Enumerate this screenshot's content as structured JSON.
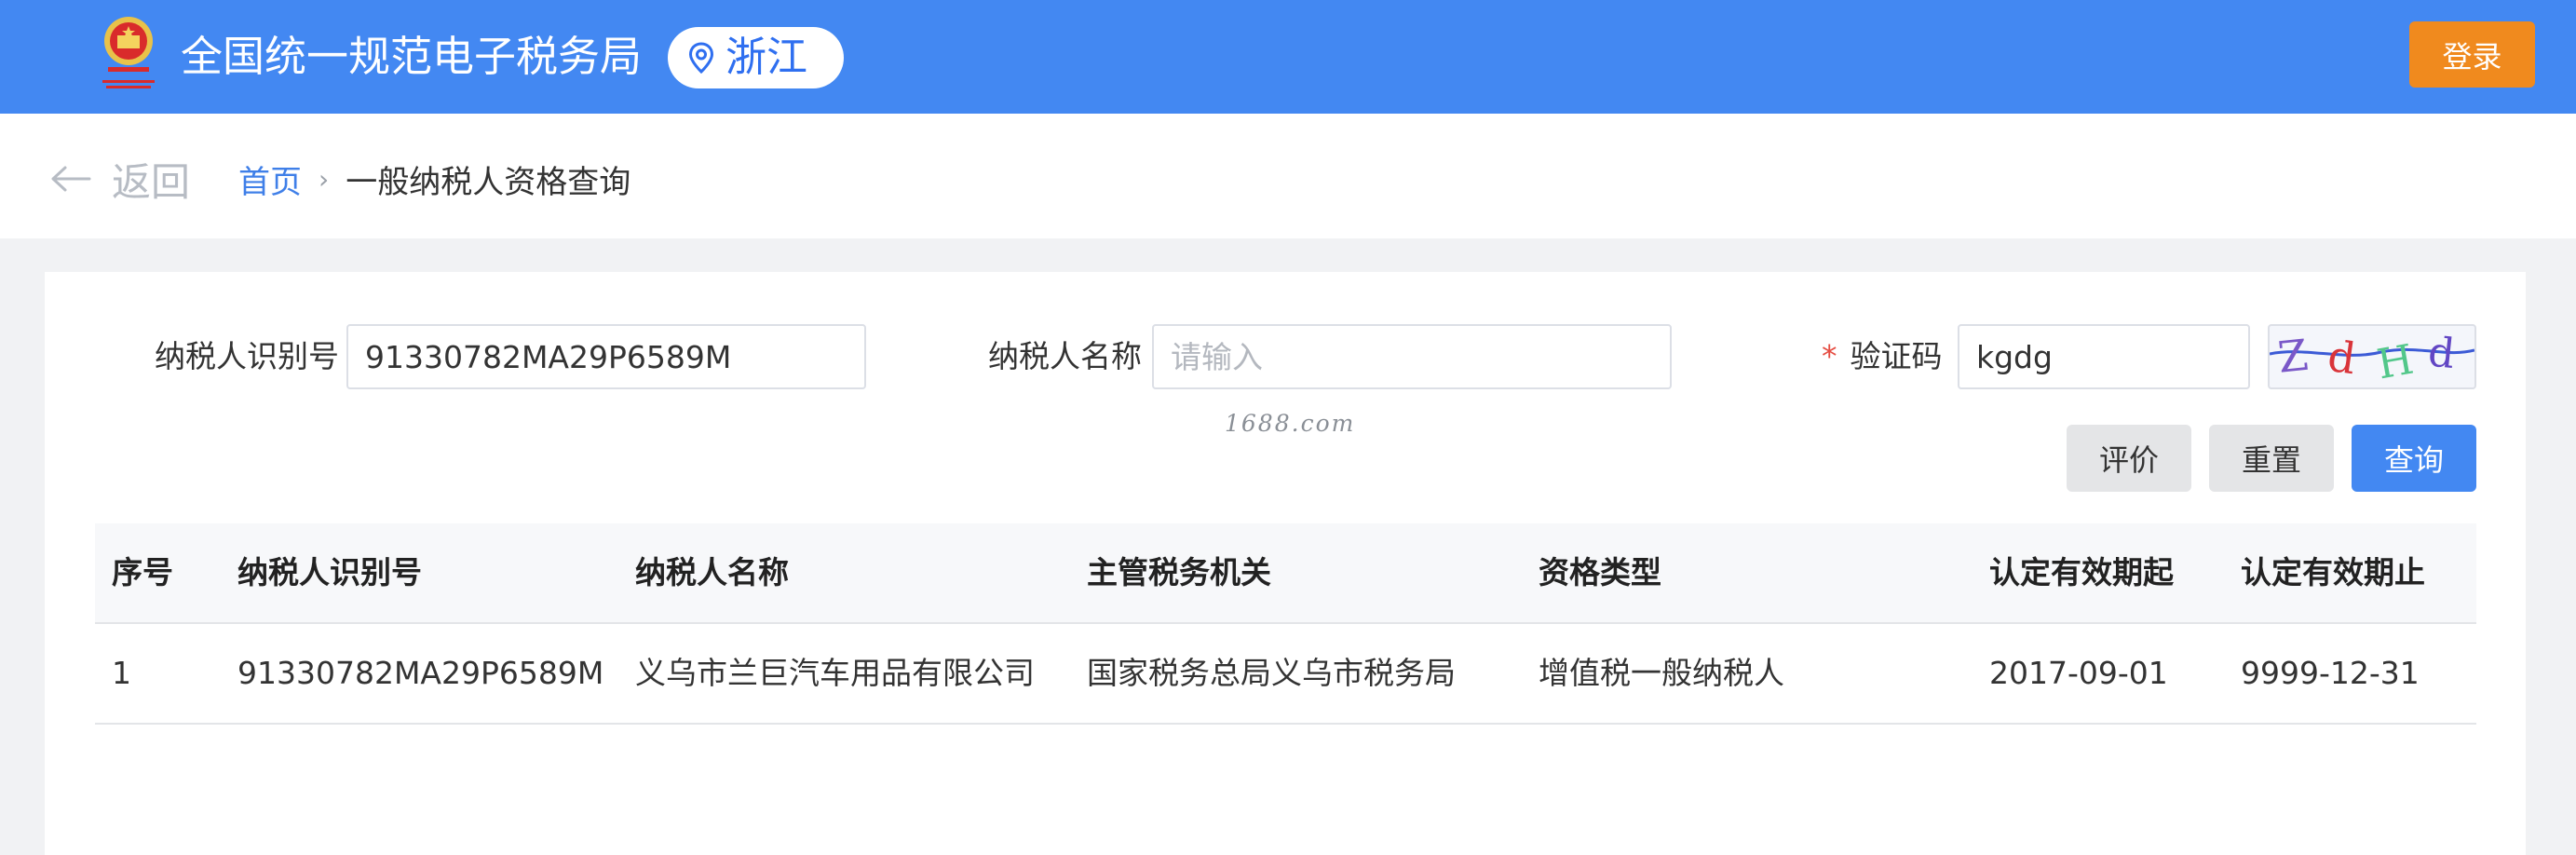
{
  "header": {
    "site_title": "全国统一规范电子税务局",
    "region": "浙江",
    "login_label": "登录",
    "emblem_icon": "national-emblem-icon",
    "pin_icon": "location-pin-icon"
  },
  "breadcrumb": {
    "back_label": "返回",
    "home_label": "首页",
    "separator": "›",
    "current_label": "一般纳税人资格查询"
  },
  "form": {
    "taxpayer_id_label": "纳税人识别号",
    "taxpayer_id_value": "91330782MA29P6589M",
    "taxpayer_name_label": "纳税人名称",
    "taxpayer_name_placeholder": "请输入",
    "taxpayer_name_value": "",
    "required_mark": "*",
    "captcha_label": "验证码",
    "captcha_value": "kgdg",
    "captcha_image_text": "ZdHd"
  },
  "watermark": "1688.com",
  "buttons": {
    "rate_label": "评价",
    "reset_label": "重置",
    "query_label": "查询"
  },
  "table": {
    "columns": [
      "序号",
      "纳税人识别号",
      "纳税人名称",
      "主管税务机关",
      "资格类型",
      "认定有效期起",
      "认定有效期止"
    ],
    "rows": [
      [
        "1",
        "91330782MA29P6589M",
        "义乌市兰巨汽车用品有限公司",
        "国家税务总局义乌市税务局",
        "增值税一般纳税人",
        "2017-09-01",
        "9999-12-31"
      ]
    ]
  },
  "colors": {
    "header_blue": "#4388f2",
    "login_orange": "#f08a1e",
    "link_blue": "#3f7fe8",
    "required_red": "#e54d42"
  }
}
